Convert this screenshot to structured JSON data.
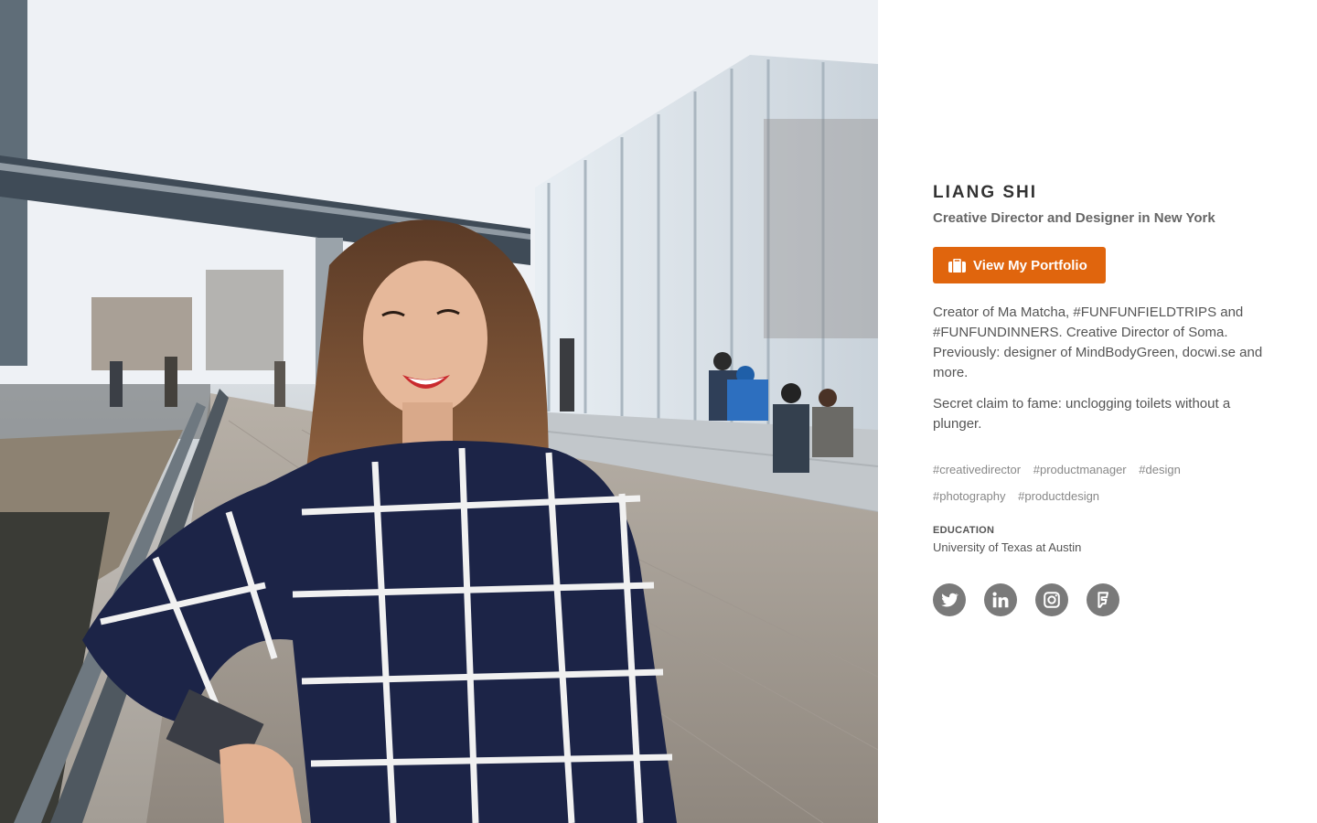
{
  "profile": {
    "name": "LIANG SHI",
    "headline": "Creative Director and Designer in New York",
    "portfolio_button": {
      "label": "View My Portfolio",
      "icon": "briefcase-icon",
      "color": "#e0650d"
    },
    "bio": [
      "Creator of Ma Matcha, #FUNFUNFIELDTRIPS and #FUNFUNDINNERS. Creative Director of Soma. Previously: designer of MindBodyGreen, docwi.se and more.",
      "Secret claim to fame: unclogging toilets without a plunger."
    ],
    "tags": [
      "#creativedirector",
      "#productmanager",
      "#design",
      "#photography",
      "#productdesign"
    ],
    "education": {
      "label": "EDUCATION",
      "value": "University of Texas at Austin"
    },
    "social": [
      {
        "name": "twitter",
        "icon": "twitter-icon"
      },
      {
        "name": "linkedin",
        "icon": "linkedin-icon"
      },
      {
        "name": "instagram",
        "icon": "instagram-icon"
      },
      {
        "name": "foursquare",
        "icon": "foursquare-icon"
      }
    ]
  },
  "colors": {
    "accent": "#e0650d",
    "social_icon_bg": "#7a7a7a",
    "name_text": "#333333",
    "body_text": "#555555",
    "tag_text": "#888888"
  }
}
